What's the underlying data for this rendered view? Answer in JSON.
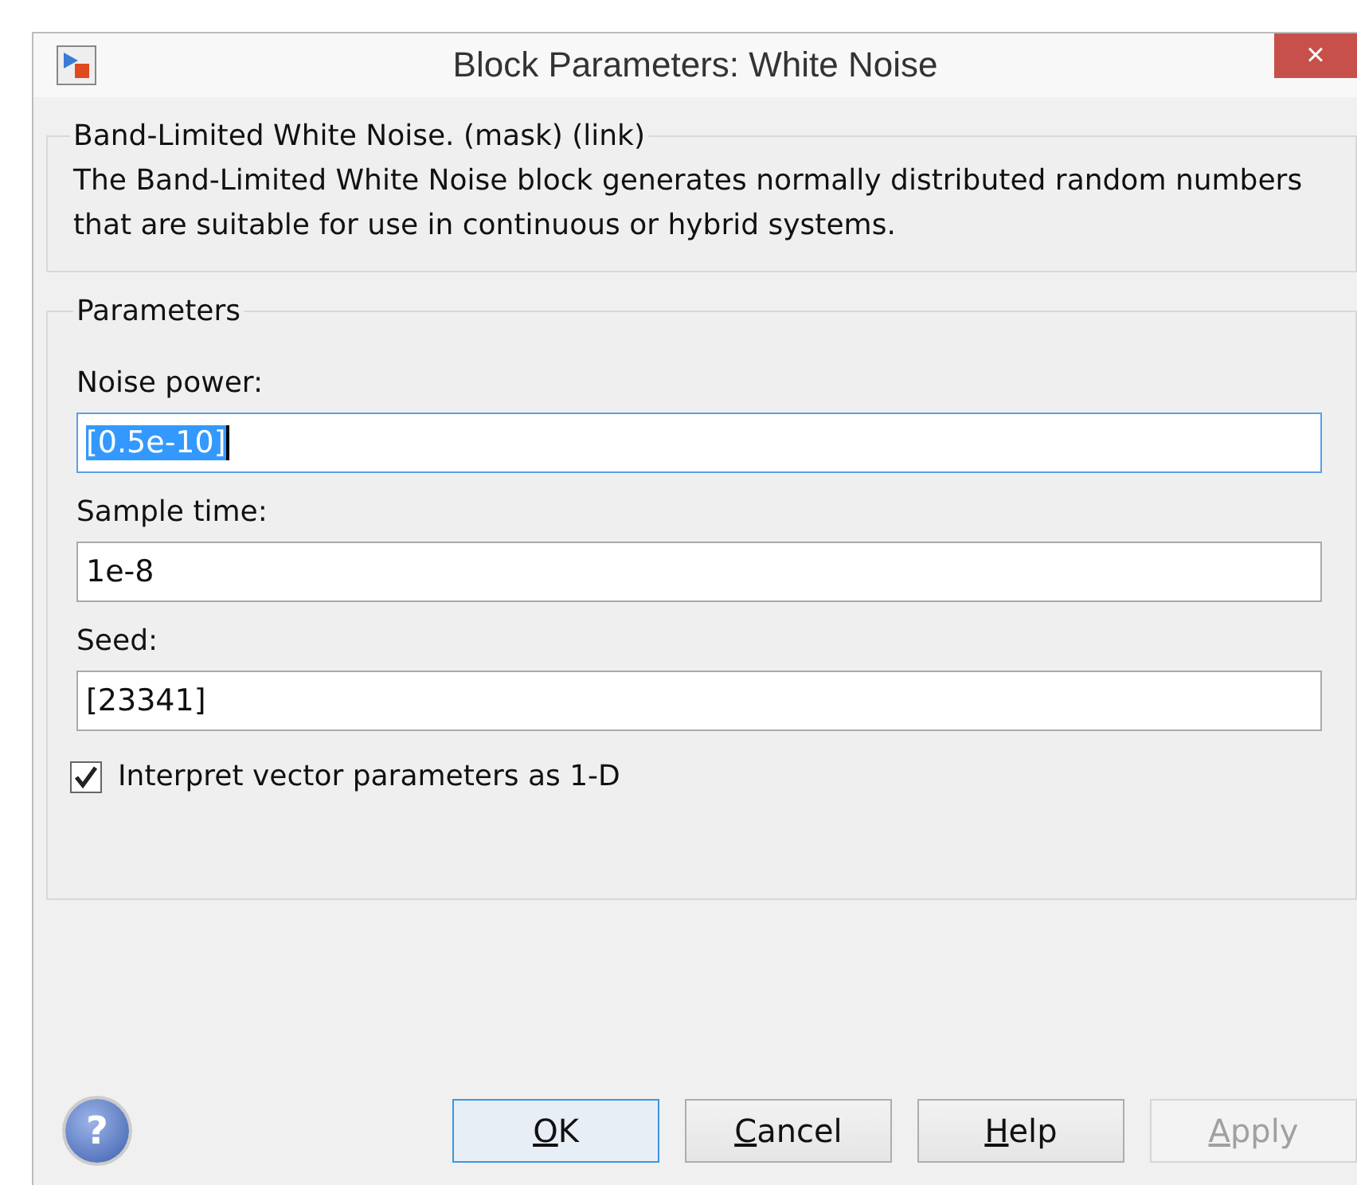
{
  "window": {
    "title": "Block Parameters: White Noise",
    "close": "×"
  },
  "description": {
    "title": "Band-Limited White Noise. (mask) (link)",
    "text": "The Band-Limited White Noise block generates normally distributed random numbers that are suitable for use in continuous or hybrid systems."
  },
  "parameters": {
    "title": "Parameters",
    "fields": [
      {
        "label": "Noise power:",
        "value": "[0.5e-10]",
        "focused": true,
        "text_selected": true
      },
      {
        "label": "Sample time:",
        "value": "1e-8",
        "focused": false,
        "text_selected": false
      },
      {
        "label": "Seed:",
        "value": "[23341]",
        "focused": false,
        "text_selected": false
      }
    ],
    "checkbox": {
      "label": "Interpret vector parameters as 1-D",
      "checked": true
    }
  },
  "help_icon": "?",
  "buttons": [
    {
      "mnemonic": "O",
      "rest": "K",
      "default": true,
      "disabled": false
    },
    {
      "mnemonic": "C",
      "rest": "ancel",
      "default": false,
      "disabled": false
    },
    {
      "mnemonic": "H",
      "rest": "elp",
      "default": false,
      "disabled": false
    },
    {
      "mnemonic": "A",
      "rest": "pply",
      "default": false,
      "disabled": true
    }
  ]
}
